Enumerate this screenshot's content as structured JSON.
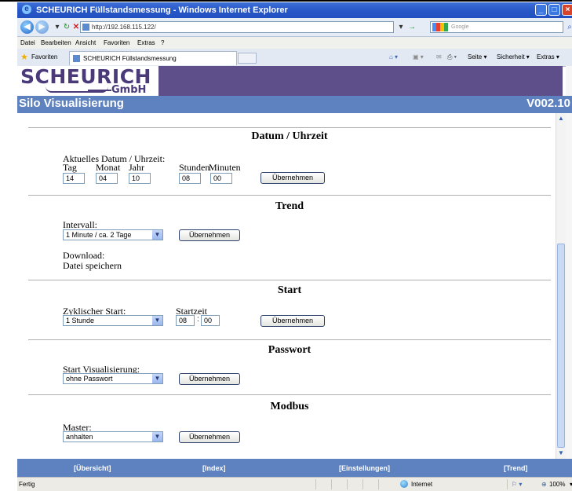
{
  "browser": {
    "title": "SCHEURICH Füllstandsmessung - Windows Internet Explorer",
    "url": "http://192.168.115.122/",
    "search_placeholder": "Google",
    "menu": [
      "Datei",
      "Bearbeiten",
      "Ansicht",
      "Favoriten",
      "Extras",
      "?"
    ],
    "favorites_label": "Favoriten",
    "tab_title": "SCHEURICH Füllstandsmessung",
    "commands": {
      "page": "Seite",
      "safety": "Sicherheit",
      "tools": "Extras"
    }
  },
  "header": {
    "logo_main": "SCHEURICH",
    "logo_sub": "GmbH",
    "title": "Silo Visualisierung",
    "version": "V002.10"
  },
  "datum": {
    "heading": "Datum / Uhrzeit",
    "current_label": "Aktuelles Datum / Uhrzeit:",
    "labels": {
      "tag": "Tag",
      "monat": "Monat",
      "jahr": "Jahr",
      "stunden": "Stunden",
      "minuten": "Minuten"
    },
    "values": {
      "tag": "14",
      "monat": "04",
      "jahr": "10",
      "stunden": "08",
      "minuten": "00"
    },
    "button": "Übernehmen"
  },
  "trend": {
    "heading": "Trend",
    "interval_label": "Intervall:",
    "interval_value": "1 Minute / ca. 2 Tage",
    "button": "Übernehmen",
    "download_label": "Download:",
    "download_link": "Datei speichern"
  },
  "start": {
    "heading": "Start",
    "cyclic_label": "Zyklischer Start:",
    "cyclic_value": "1 Stunde",
    "time_label": "Startzeit",
    "time_hours": "08",
    "time_sep": ":",
    "time_minutes": "00",
    "button": "Übernehmen"
  },
  "passwort": {
    "heading": "Passwort",
    "label": "Start Visualisierung:",
    "value": "ohne Passwort",
    "button": "Übernehmen"
  },
  "modbus": {
    "heading": "Modbus",
    "label": "Master:",
    "value": "anhalten",
    "button": "Übernehmen"
  },
  "footer": [
    "[Übersicht]",
    "[Index]",
    "[Einstellungen]",
    "[Trend]"
  ],
  "status": {
    "left": "Fertig",
    "zone": "Internet",
    "zoom": "100%"
  }
}
